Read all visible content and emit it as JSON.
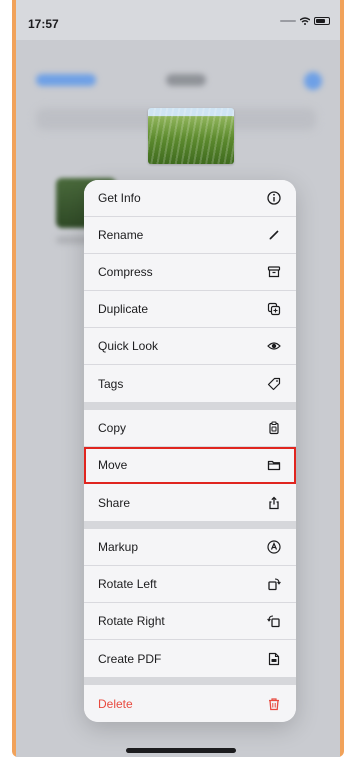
{
  "status_bar": {
    "time": "17:57"
  },
  "menu": {
    "groups": [
      [
        {
          "label": "Get Info",
          "icon": "info-icon"
        },
        {
          "label": "Rename",
          "icon": "pencil-icon"
        },
        {
          "label": "Compress",
          "icon": "archive-box-icon"
        },
        {
          "label": "Duplicate",
          "icon": "duplicate-icon"
        },
        {
          "label": "Quick Look",
          "icon": "eye-icon"
        },
        {
          "label": "Tags",
          "icon": "tag-icon"
        }
      ],
      [
        {
          "label": "Copy",
          "icon": "copy-icon"
        },
        {
          "label": "Move",
          "icon": "folder-icon",
          "highlighted": true
        },
        {
          "label": "Share",
          "icon": "share-icon"
        }
      ],
      [
        {
          "label": "Markup",
          "icon": "markup-icon"
        },
        {
          "label": "Rotate Left",
          "icon": "rotate-left-icon"
        },
        {
          "label": "Rotate Right",
          "icon": "rotate-right-icon"
        },
        {
          "label": "Create PDF",
          "icon": "pdf-document-icon"
        }
      ],
      [
        {
          "label": "Delete",
          "icon": "trash-icon",
          "destructive": true
        }
      ]
    ]
  },
  "colors": {
    "frame_accent": "#f1a25a",
    "highlight": "#e0251f",
    "destructive": "#e84a3f"
  }
}
